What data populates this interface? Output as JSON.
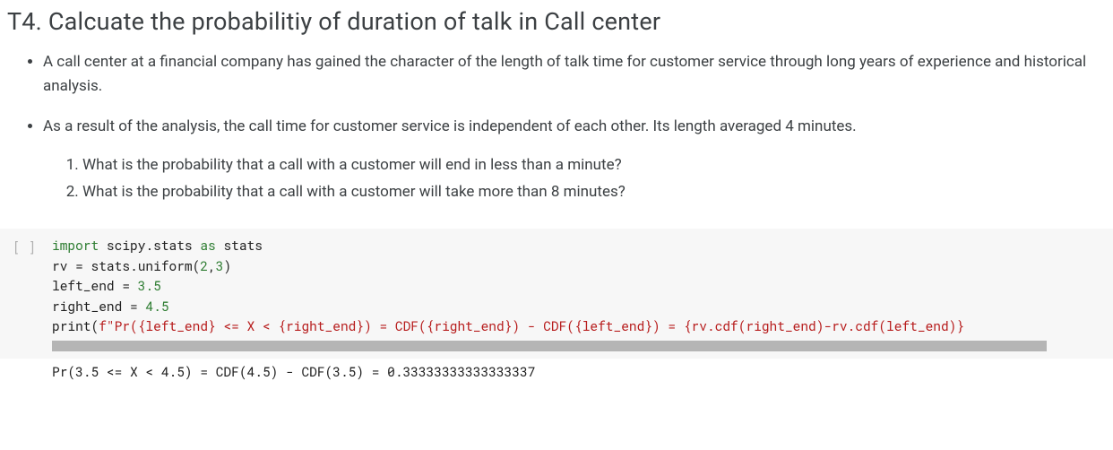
{
  "heading": "T4. Calcuate the probabilitiy of duration of talk in Call center",
  "bullets": [
    "A call center at a financial company has gained the character of the length of talk time for customer service through long years of experience and historical analysis.",
    "As a result of the analysis, the call time for customer service is independent of each other. Its length averaged 4 minutes."
  ],
  "questions": [
    "What is the probability that a call with a customer will end in less than a minute?",
    "What is the probability that a call with a customer will take more than 8 minutes?"
  ],
  "cell": {
    "prompt": "[ ]",
    "code": {
      "line1": {
        "import": "import",
        "module": " scipy.stats ",
        "as": "as",
        "alias": " stats"
      },
      "line2": {
        "lhs": "rv = stats.uniform(",
        "n1": "2",
        "comma": ",",
        "n2": "3",
        "rparen": ")"
      },
      "line3": {
        "lhs": "left_end = ",
        "val": "3.5"
      },
      "line4": {
        "lhs": "right_end = ",
        "val": "4.5"
      },
      "line5_blank": "",
      "line6": {
        "print": "print",
        "open": "(",
        "fstr": "f\"Pr({left_end} <= X < {right_end}) = CDF({right_end}) - CDF({left_end}) = {rv.cdf(right_end)-rv.cdf(left_end)}"
      }
    },
    "output": "Pr(3.5 <= X < 4.5) = CDF(4.5) - CDF(3.5) = 0.33333333333333337"
  }
}
